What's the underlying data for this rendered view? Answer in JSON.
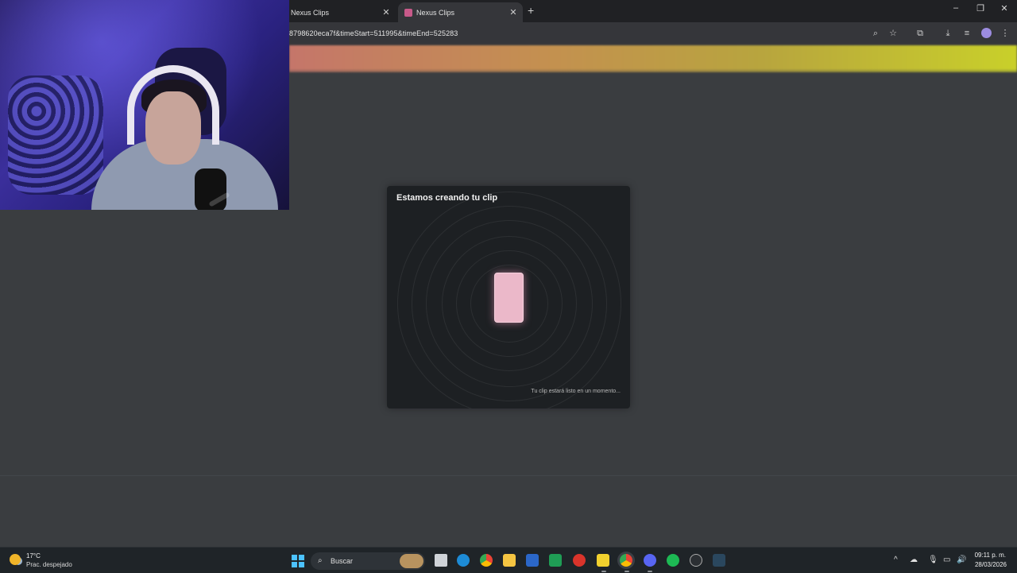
{
  "browser": {
    "tabs": [
      {
        "label": "Nexus Clips",
        "active": false
      },
      {
        "label": "Nexus Clips",
        "active": true
      }
    ],
    "url": "8798620eca7f&timeStart=511995&timeEnd=525283",
    "toolbar_icons": [
      "zoom-icon",
      "star-icon",
      "extensions-icon",
      "download-icon",
      "media-icon",
      "profile-avatar",
      "menu-icon"
    ]
  },
  "modal": {
    "title": "Estamos creando tu clip",
    "footer": "Tu clip estará listo en un momento..."
  },
  "taskbar": {
    "weather_temp": "17°C",
    "weather_condition": "Prac. despejado",
    "search_label": "Buscar",
    "time": "09:11 p. m.",
    "date": "28/03/2026"
  },
  "colors": {
    "accent_phone": "#ebb8c9",
    "page_bg": "#3a3d40",
    "modal_bg": "#1d2023"
  }
}
